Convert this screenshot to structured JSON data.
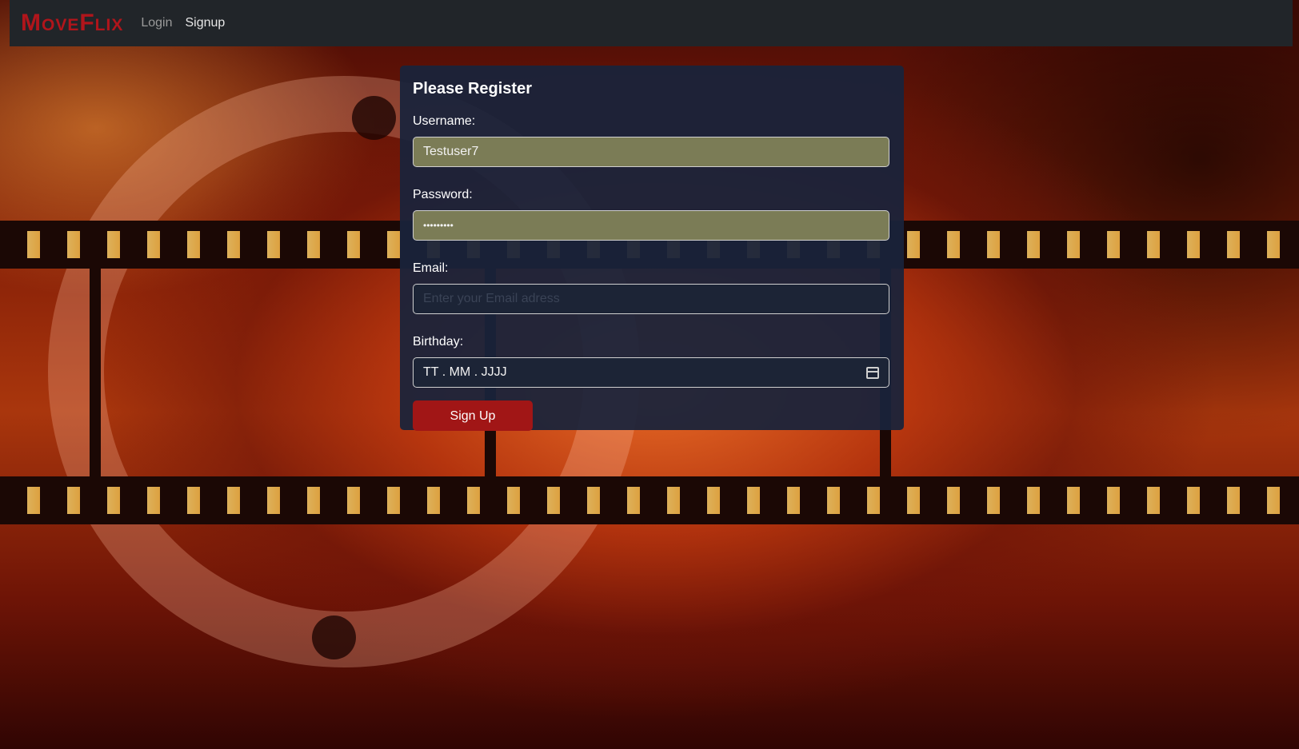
{
  "navbar": {
    "brand": "MoveFlix",
    "links": {
      "login": "Login",
      "signup": "Signup"
    }
  },
  "form": {
    "title": "Please Register",
    "username": {
      "label": "Username:",
      "value": "Testuser7"
    },
    "password": {
      "label": "Password:",
      "value": "•••••••••"
    },
    "email": {
      "label": "Email:",
      "value": "",
      "placeholder": "Enter your Email adress"
    },
    "birthday": {
      "label": "Birthday:",
      "value": "TT . MM . JJJJ",
      "icon": "calendar-icon"
    },
    "submit_label": "Sign Up"
  },
  "colors": {
    "brand": "#b0151b",
    "navbar_bg": "#212529",
    "card_bg": "#19233a",
    "autofill_bg": "#7b7c56",
    "button": "#a11616"
  }
}
